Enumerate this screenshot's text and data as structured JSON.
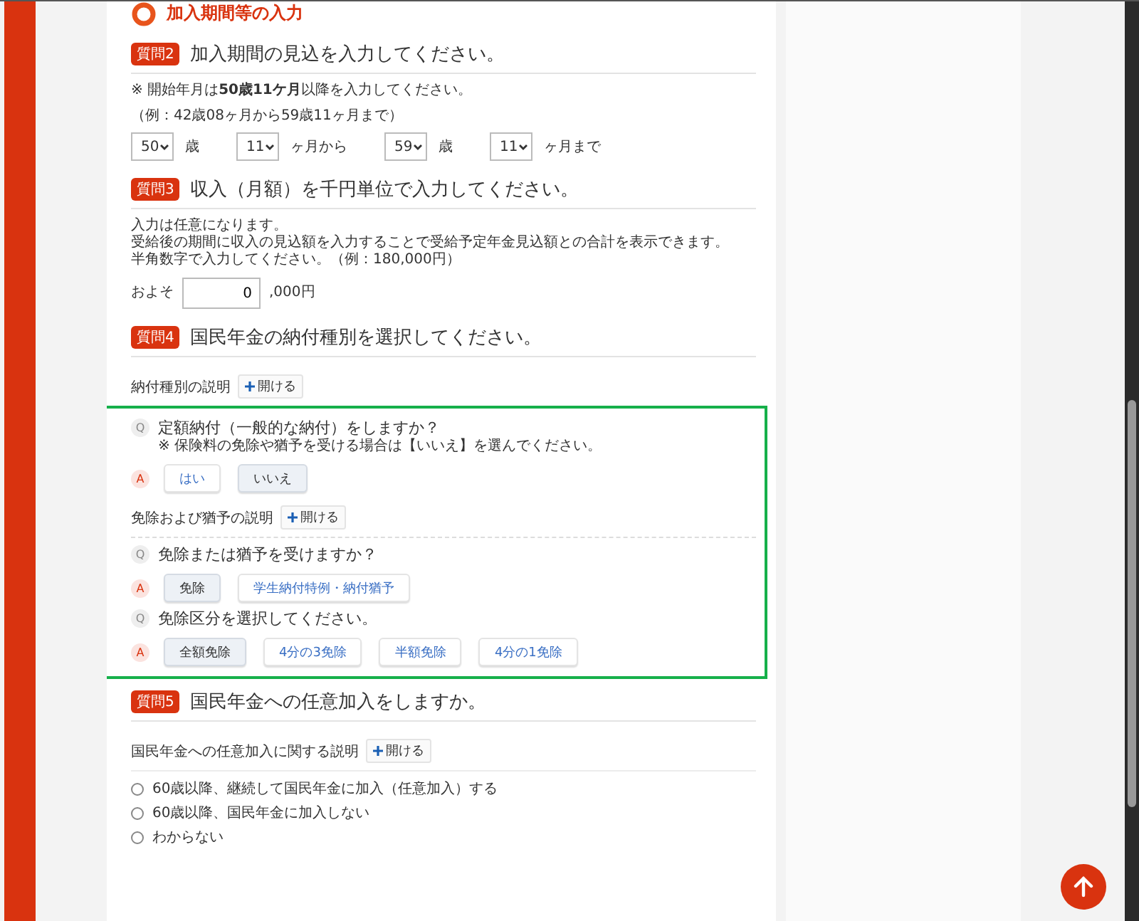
{
  "section_title": "加入期間等の入力",
  "questions": [
    {
      "kind": "period",
      "badge": "質問2",
      "title": "加入期間の見込を入力してください。",
      "note": "※ 開始年月は**50歳11ケ月**以降を入力してください。",
      "example": "（例：42歳08ヶ月から59歳11ヶ月まで）",
      "selects": [
        {
          "value": "50",
          "unit": "歳"
        },
        {
          "value": "11",
          "unit": "ヶ月から"
        },
        {
          "value": "59",
          "unit": "歳"
        },
        {
          "value": "11",
          "unit": "ヶ月まで"
        }
      ]
    },
    {
      "kind": "income",
      "badge": "質問3",
      "title": "収入（月額）を千円単位で入力してください。",
      "lines": [
        "入力は任意になります。",
        "受給後の期間に収入の見込額を入力することで受給予定年金見込額との合計を表示できます。",
        "半角数字で入力してください。（例：180,000円）"
      ],
      "prefix": "およそ",
      "value": "0",
      "suffix": ",000円"
    },
    {
      "kind": "payment",
      "badge": "質問4",
      "title": "国民年金の納付種別を選択してください。",
      "explain": {
        "label": "納付種別の説明",
        "button": "開ける"
      },
      "highlighted": true,
      "blocks": [
        {
          "kind": "qa",
          "q_mark": "Q",
          "question": "定額納付（一般的な納付）をしますか？",
          "note": "※ 保険料の免除や猶予を受ける場合は【いいえ】を選んでください。",
          "a_mark": "A",
          "options": [
            {
              "label": "はい",
              "selected": false
            },
            {
              "label": "いいえ",
              "selected": true
            }
          ]
        },
        {
          "kind": "explain",
          "label": "免除および猶予の説明",
          "button": "開ける"
        },
        {
          "kind": "qa",
          "q_mark": "Q",
          "question": "免除または猶予を受けますか？",
          "a_mark": "A",
          "options": [
            {
              "label": "免除",
              "selected": true
            },
            {
              "label": "学生納付特例・納付猶予",
              "selected": false
            }
          ]
        },
        {
          "kind": "qa",
          "q_mark": "Q",
          "question": "免除区分を選択してください。",
          "a_mark": "A",
          "options": [
            {
              "label": "全額免除",
              "selected": true
            },
            {
              "label": "4分の3免除",
              "selected": false
            },
            {
              "label": "半額免除",
              "selected": false
            },
            {
              "label": "4分の1免除",
              "selected": false
            }
          ]
        }
      ]
    },
    {
      "kind": "radio",
      "badge": "質問5",
      "title": "国民年金への任意加入をしますか。",
      "explain": {
        "label": "国民年金への任意加入に関する説明",
        "button": "開ける"
      },
      "options": [
        {
          "label": "60歳以降、継続して国民年金に加入（任意加入）する",
          "selected": false
        },
        {
          "label": "60歳以降、国民年金に加入しない",
          "selected": false
        },
        {
          "label": "わからない",
          "selected": false
        }
      ]
    }
  ]
}
